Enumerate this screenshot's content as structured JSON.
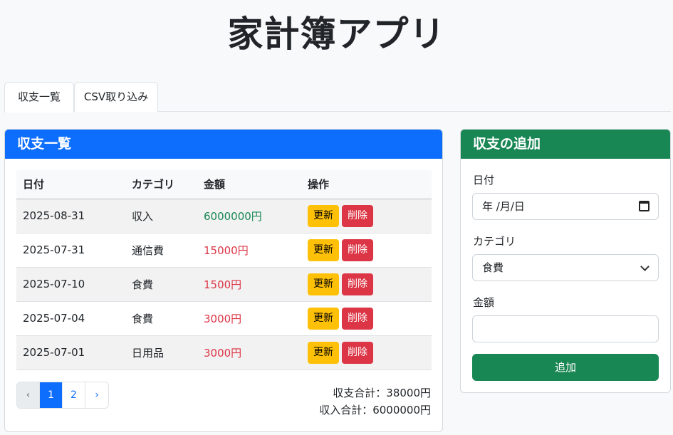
{
  "app": {
    "title": "家計簿アプリ"
  },
  "tabs": [
    {
      "label": "収支一覧",
      "active": true
    },
    {
      "label": "CSV取り込み",
      "active": false
    }
  ],
  "list_card": {
    "header": "収支一覧",
    "columns": [
      "日付",
      "カテゴリ",
      "金額",
      "操作"
    ],
    "rows": [
      {
        "date": "2025-08-31",
        "category": "収入",
        "amount": "6000000円",
        "type": "income"
      },
      {
        "date": "2025-07-31",
        "category": "通信費",
        "amount": "15000円",
        "type": "expense"
      },
      {
        "date": "2025-07-10",
        "category": "食費",
        "amount": "1500円",
        "type": "expense"
      },
      {
        "date": "2025-07-04",
        "category": "食費",
        "amount": "3000円",
        "type": "expense"
      },
      {
        "date": "2025-07-01",
        "category": "日用品",
        "amount": "3000円",
        "type": "expense"
      }
    ],
    "update_label": "更新",
    "delete_label": "削除",
    "pagination": {
      "prev": "‹",
      "pages": [
        "1",
        "2"
      ],
      "current": "1",
      "next": "›"
    },
    "totals": {
      "balance": "収支合計：38000円",
      "income": "収入合計：6000000円"
    }
  },
  "add_card": {
    "header": "収支の追加",
    "date_label": "日付",
    "date_value": "年 /月/日",
    "category_label": "カテゴリ",
    "category_value": "食費",
    "amount_label": "金額",
    "amount_value": "",
    "submit_label": "追加"
  },
  "colors": {
    "primary": "#0d6efd",
    "success": "#198754",
    "warning": "#ffc107",
    "danger": "#dc3545"
  }
}
